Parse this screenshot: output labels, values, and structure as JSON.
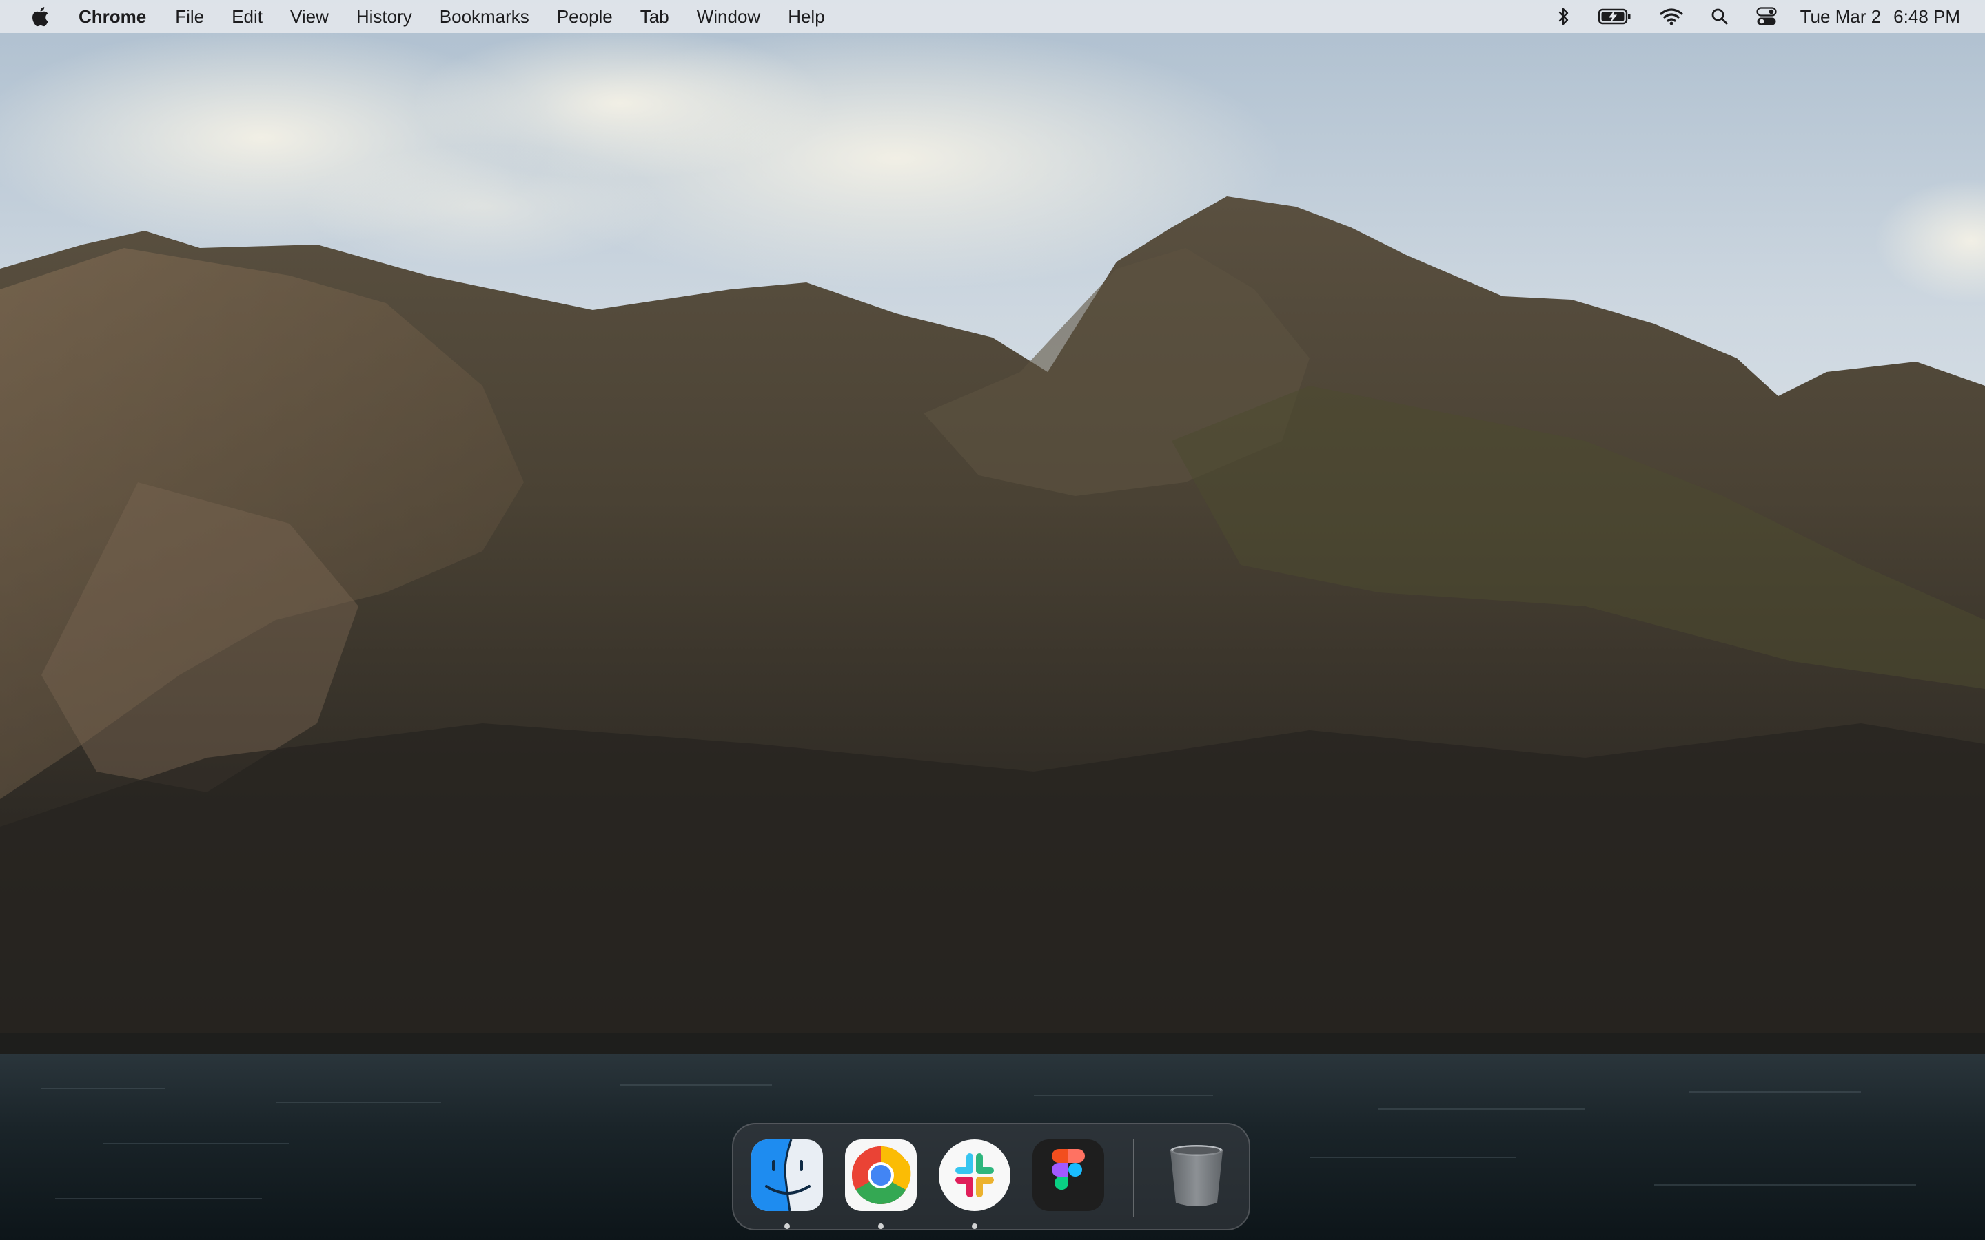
{
  "menubar": {
    "app_name": "Chrome",
    "items": [
      "File",
      "Edit",
      "View",
      "History",
      "Bookmarks",
      "People",
      "Tab",
      "Window",
      "Help"
    ],
    "clock": {
      "date": "Tue Mar 2",
      "time": "6:48 PM"
    }
  },
  "dock": {
    "apps": [
      {
        "name": "Finder",
        "icon": "finder-icon",
        "running": true
      },
      {
        "name": "Google Chrome",
        "icon": "chrome-icon",
        "running": true
      },
      {
        "name": "Slack",
        "icon": "slack-icon",
        "running": true
      },
      {
        "name": "Figma",
        "icon": "figma-icon",
        "running": false
      },
      {
        "name": "Trash",
        "icon": "trash-icon",
        "running": false
      }
    ]
  },
  "colors": {
    "menubar_bg": "#e8eaee",
    "chrome_red": "#ea4335",
    "chrome_yellow": "#fbbc05",
    "chrome_green": "#34a853",
    "chrome_blue": "#4285f4",
    "finder_blue": "#1e8cf0",
    "figma_red": "#f24e1e",
    "figma_purple": "#a259ff",
    "figma_blue": "#1abcfe",
    "figma_green": "#0acf83",
    "slack_blue": "#36c5f0",
    "slack_green": "#2eb67d",
    "slack_red": "#e01e5a",
    "slack_yellow": "#ecb22e"
  }
}
